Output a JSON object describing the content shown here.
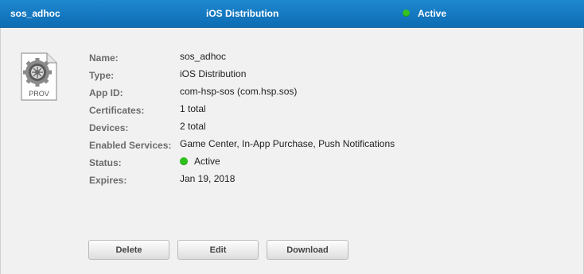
{
  "header": {
    "name": "sos_adhoc",
    "type": "iOS Distribution",
    "status": "Active",
    "status_color": "#35c420",
    "background": "#1479c2"
  },
  "icon": {
    "name": "provisioning-profile-icon",
    "caption": "PROV"
  },
  "details": {
    "name_label": "Name:",
    "name_value": "sos_adhoc",
    "type_label": "Type:",
    "type_value": "iOS Distribution",
    "appid_label": "App ID:",
    "appid_value": "com-hsp-sos (com.hsp.sos)",
    "certs_label": "Certificates:",
    "certs_value": "1 total",
    "devices_label": "Devices:",
    "devices_value": "2 total",
    "services_label": "Enabled Services:",
    "services_value": "Game Center, In-App Purchase, Push Notifications",
    "status_label": "Status:",
    "status_value": "Active",
    "expires_label": "Expires:",
    "expires_value": "Jan 19, 2018"
  },
  "buttons": {
    "delete": "Delete",
    "edit": "Edit",
    "download": "Download"
  }
}
